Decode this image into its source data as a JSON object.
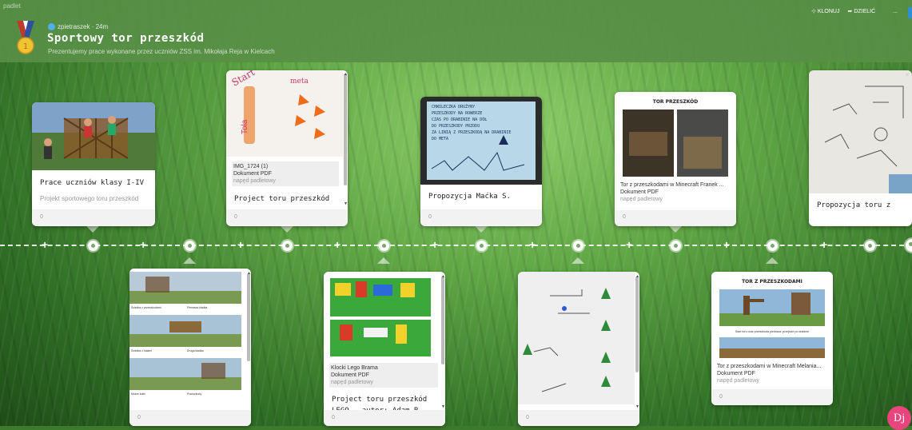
{
  "header": {
    "brand": "padlet",
    "author": "zpietraszek",
    "time": "24m",
    "title": "Sportowy tor przeszkód",
    "subtitle": "Prezentujemy prace wykonane przez uczniów ZSS im. Mikołaja Reja w Kielcach",
    "actions": {
      "clone": "KLONUJ",
      "share": "DZIELIĆ",
      "more": "..."
    }
  },
  "cards_top": [
    {
      "title": "Prace uczniów klasy I-IV",
      "desc": "Projekt sportowego toru przeszkód",
      "count": "0"
    },
    {
      "doc_name": "IMG_1724 (1)",
      "doc_type": "Dokument PDF",
      "doc_source": "napęd padletowy",
      "title": "Project toru przeszkód",
      "count": "0"
    },
    {
      "title": "Propozycja Maćka S.",
      "count": "0"
    },
    {
      "doc_name": "Tor z przeszkodami w Minecraft Franek ...",
      "doc_type": "Dokument PDF",
      "doc_source": "napęd padletowy",
      "img_heading": "TOR PRZESZKÓD",
      "count": "0"
    },
    {
      "title": "Propozycja toru z",
      "count": ""
    }
  ],
  "cards_bottom": [
    {
      "count": "0",
      "captions": [
        "Ścieżka z przeszkodami",
        "Pierwsza kładka",
        "Ścieżka z kołami",
        "Druga kładka",
        "Mokre kołki",
        "Przeszkody"
      ]
    },
    {
      "doc_name": "Klocki Lego Brama",
      "doc_type": "Dokument PDF",
      "doc_source": "napęd padletowy",
      "title": "Project toru przeszkód",
      "title2": "LEGO - autor: Adam R.",
      "count": "0"
    },
    {
      "count": "0"
    },
    {
      "img_heading": "TOR Z PRZESZKODAMI",
      "img_caption": "Start toru oraz przeszkoda pierwsza: przejście po drabinie",
      "doc_name": "Tor z przeszkodami w Minecraft Melania...",
      "doc_type": "Dokument PDF",
      "doc_source": "napęd padletowy",
      "count": "0"
    }
  ],
  "sketch_text": [
    "CHWILECZKA DRUŻYNY",
    "PRZESZKODY NA ROWERZE",
    "CZAS PO DRABINIE NA DÓŁ",
    "DO PRZESZKODY PRZODU",
    "ZA LINIĄ Z PRZESZKODĄ NA DRABINIE",
    "DO META"
  ],
  "fab_label": "Dj",
  "colors": {
    "header": "#588f46",
    "accent_fab": "#e8457f",
    "avatar": "#4fb0e8"
  }
}
